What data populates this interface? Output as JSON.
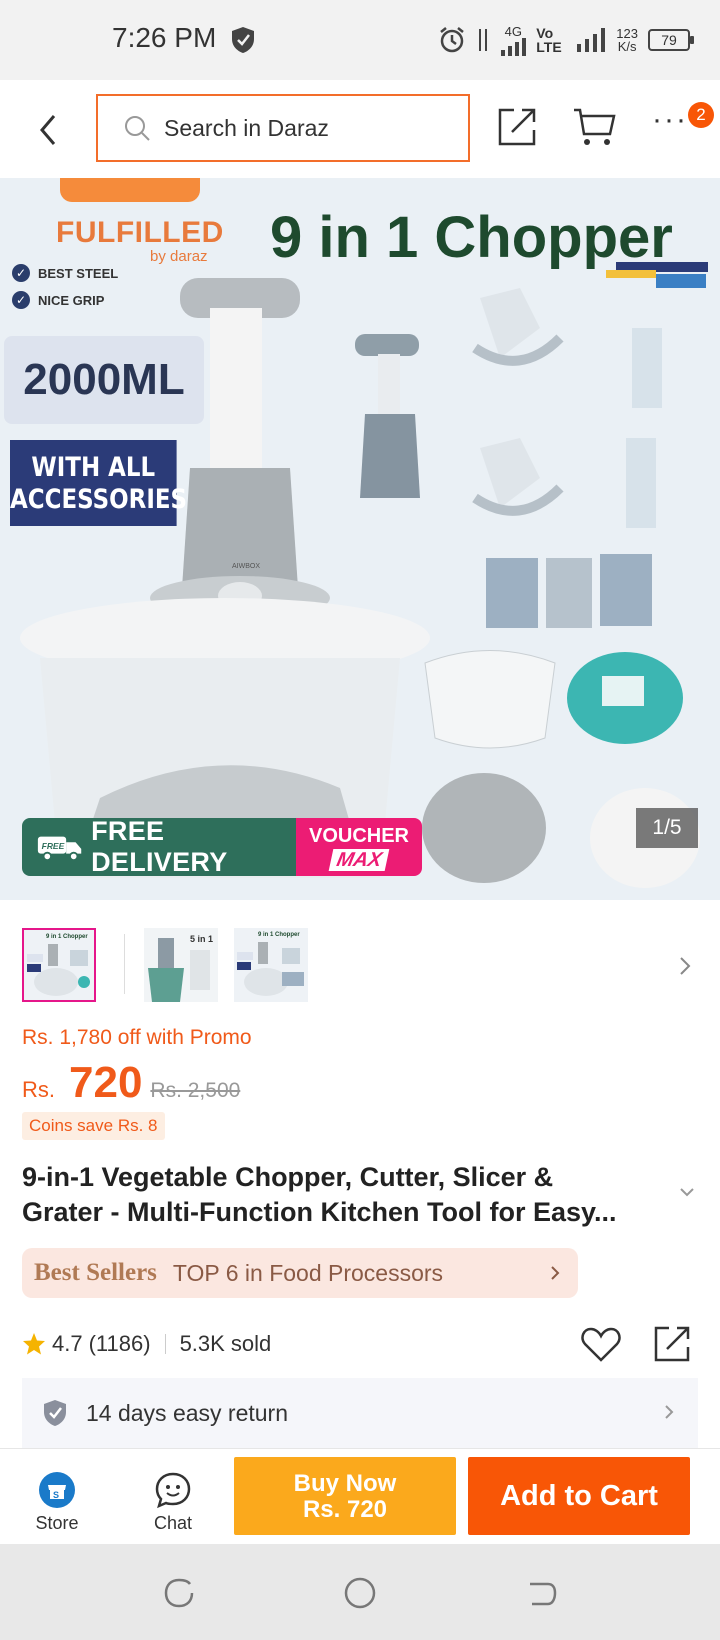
{
  "status_bar": {
    "time": "7:26 PM",
    "network_4g": "4G",
    "network_volte": "Vo LTE",
    "speed_value": "123",
    "speed_unit": "K/s",
    "battery": "79"
  },
  "top_nav": {
    "search_placeholder": "Search in Daraz",
    "cart_badge": "2"
  },
  "hero": {
    "fulfilled_label": "FULFILLED",
    "by_label": "by daraz",
    "title": "9 in 1 Chopper",
    "feature_1": "BEST STEEL",
    "feature_2": "NICE GRIP",
    "capacity": "2000ML",
    "accessories_1": "WITH ALL",
    "accessories_2": "ACCESSORIES",
    "brand_mark": "AIWBOX",
    "delivery_free_tag": "FREE",
    "delivery_text": "FREE DELIVERY",
    "voucher_line1": "VOUCHER",
    "voucher_line2": "MAX",
    "counter": "1/5"
  },
  "thumbnails": [
    {
      "caption": "9 in 1 Chopper"
    },
    {
      "caption": "5 in 1"
    },
    {
      "caption": "9 in 1 Chopper"
    }
  ],
  "price": {
    "promo": "Rs. 1,780 off with Promo",
    "currency": "Rs.",
    "current": "720",
    "original": "Rs. 2,500",
    "coins": "Coins save Rs. 8"
  },
  "product": {
    "title_line1": "9-in-1 Vegetable Chopper, Cutter, Slicer &",
    "title_line2": "Grater - Multi-Function Kitchen Tool for Easy..."
  },
  "best_sellers": {
    "logo": "Best Sellers",
    "rank_text": "TOP 6 in Food Processors"
  },
  "rating": {
    "score": "4.7",
    "count": "(1186)",
    "sold": "5.3K sold"
  },
  "return_policy": {
    "text": "14 days easy return"
  },
  "action_bar": {
    "store_label": "Store",
    "chat_label": "Chat",
    "buy_now_line1": "Buy Now",
    "buy_now_line2": "Rs. 720",
    "add_to_cart": "Add to Cart"
  },
  "colors": {
    "accent_orange": "#f85606",
    "buy_now_yellow": "#fba91c",
    "voucher_pink": "#ec1c74",
    "delivery_green": "#2e6f5b"
  }
}
